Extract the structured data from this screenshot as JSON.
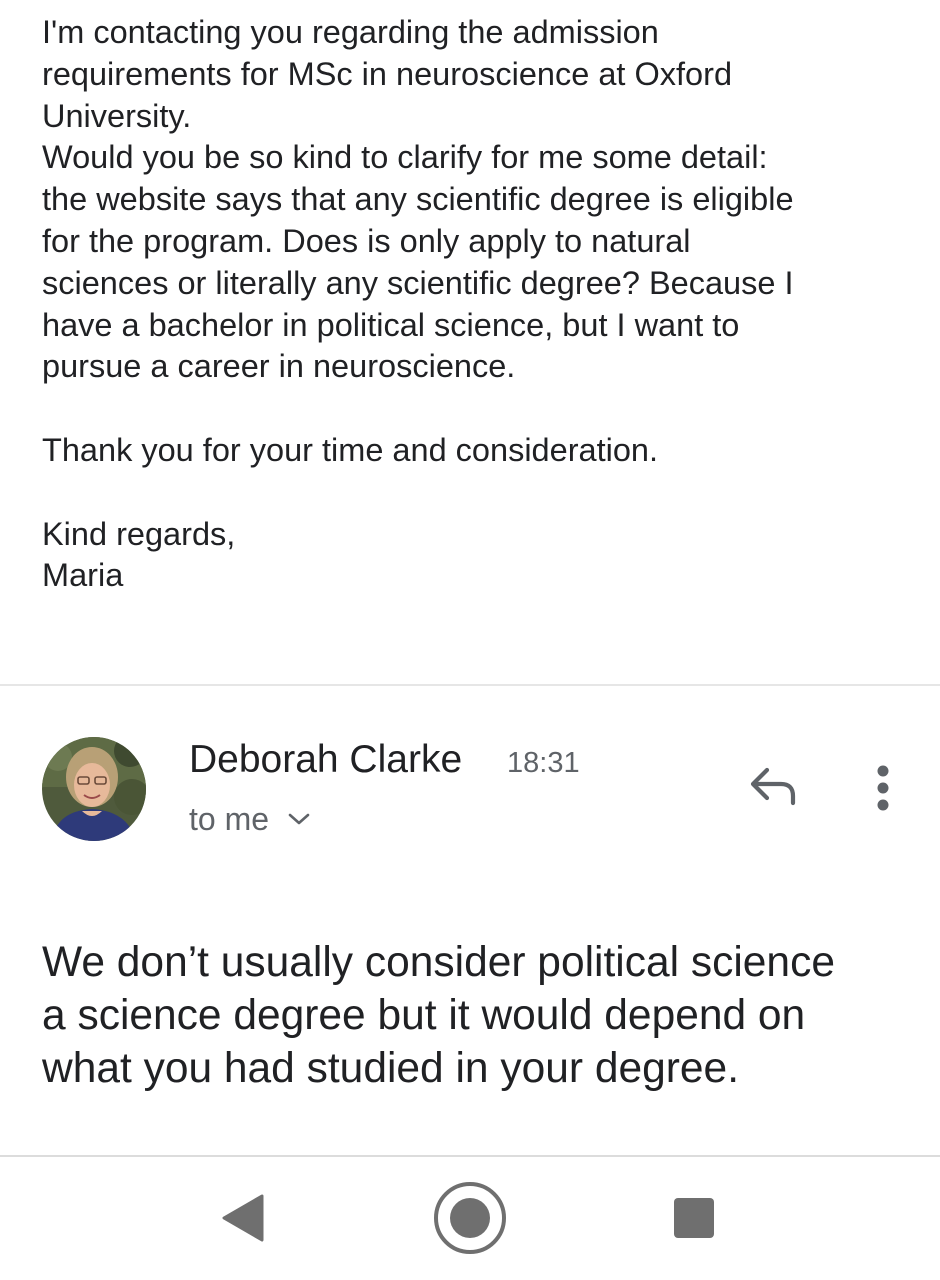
{
  "previous_message": {
    "lines": [
      "I'm contacting you regarding the admission",
      "requirements for MSc in neuroscience at Oxford",
      "University.",
      "Would you be so kind to clarify for me some detail:",
      "the website says that any scientific degree is eligible",
      "for the program. Does is only apply to natural",
      "sciences or literally any scientific degree? Because I",
      "have a bachelor in political science, but I want to",
      "pursue a career in neuroscience."
    ],
    "closing": "Thank you for your time and consideration.",
    "signoff": "Kind regards,",
    "signature": "Maria"
  },
  "reply_message": {
    "sender": {
      "name": "Deborah Clarke",
      "time": "18:31",
      "recipients": "to me",
      "avatar_icon": "avatar-photo"
    },
    "actions": {
      "reply_icon": "reply-arrow-icon",
      "more_icon": "vertical-dots-icon"
    },
    "body_lines": [
      "We don’t usually consider political science",
      "a science degree but it would depend on",
      "what you had studied in your degree."
    ]
  },
  "navigation_bar": {
    "back_icon": "triangle-back-icon",
    "home_icon": "circle-home-icon",
    "recents_icon": "square-recents-icon"
  },
  "colors": {
    "text_primary": "#202124",
    "text_secondary": "#5f6368",
    "icon_gray": "#6f6f6f",
    "divider": "#e6e6e6"
  }
}
